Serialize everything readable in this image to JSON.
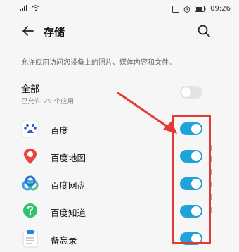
{
  "status_bar": {
    "signal_text": "⁴ᴳ",
    "battery_text": "▭",
    "time": "09:26"
  },
  "header": {
    "title": "存储"
  },
  "description": "允许应用访问您设备上的照片、媒体内容和文件。",
  "all_section": {
    "title": "全部",
    "subtitle": "已允许 29 个应用",
    "enabled": false
  },
  "apps": [
    {
      "name": "百度",
      "icon": "baidu-icon",
      "enabled": true
    },
    {
      "name": "百度地图",
      "icon": "baidu-map-icon",
      "enabled": true
    },
    {
      "name": "百度网盘",
      "icon": "baidu-netdisk-icon",
      "enabled": true
    },
    {
      "name": "百度知道",
      "icon": "baidu-zhidao-icon",
      "enabled": true
    },
    {
      "name": "备忘录",
      "icon": "memo-icon",
      "enabled": true
    }
  ],
  "colors": {
    "toggle_on": "#1fa3d8",
    "highlight": "#e53935"
  }
}
